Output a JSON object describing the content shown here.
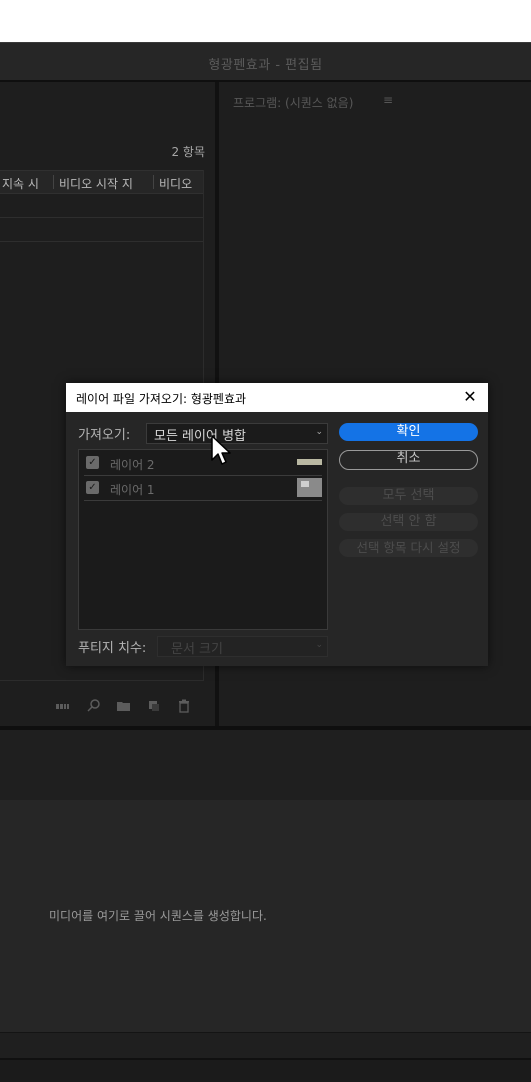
{
  "window": {
    "title": "형광펜효과 - 편집됨"
  },
  "project_panel": {
    "item_count": "2 항목",
    "columns": [
      "지속 시",
      "비디오 시작 지",
      "비디오"
    ]
  },
  "program_panel": {
    "title": "프로그램: (시퀀스 없음)",
    "menu_icon": "≡"
  },
  "timeline": {
    "hint": "미디어를 여기로 끌어 시퀀스를 생성합니다."
  },
  "dialog": {
    "title": "레이어 파일 가져오기: 형광펜효과",
    "close_icon": "✕",
    "import_label": "가져오기:",
    "import_value": "모든 레이어 병합",
    "layers": [
      {
        "name": "레이어 2",
        "checked": true
      },
      {
        "name": "레이어 1",
        "checked": true
      }
    ],
    "footage_label": "푸티지 치수:",
    "footage_value": "문서 크기",
    "buttons": {
      "ok": "확인",
      "cancel": "취소",
      "select_all": "모두 선택",
      "deselect": "선택 안 함",
      "reset": "선택 항목 다시 설정"
    }
  },
  "icons": {
    "checkbox": "✓",
    "dropdown": "⌄",
    "footer": [
      "bin-view-icon",
      "search-icon",
      "new-bin-icon",
      "new-item-icon",
      "trash-icon"
    ]
  },
  "colors": {
    "accent": "#1473e6",
    "background": "#1d1d1d",
    "dialog_bg": "#262626"
  }
}
